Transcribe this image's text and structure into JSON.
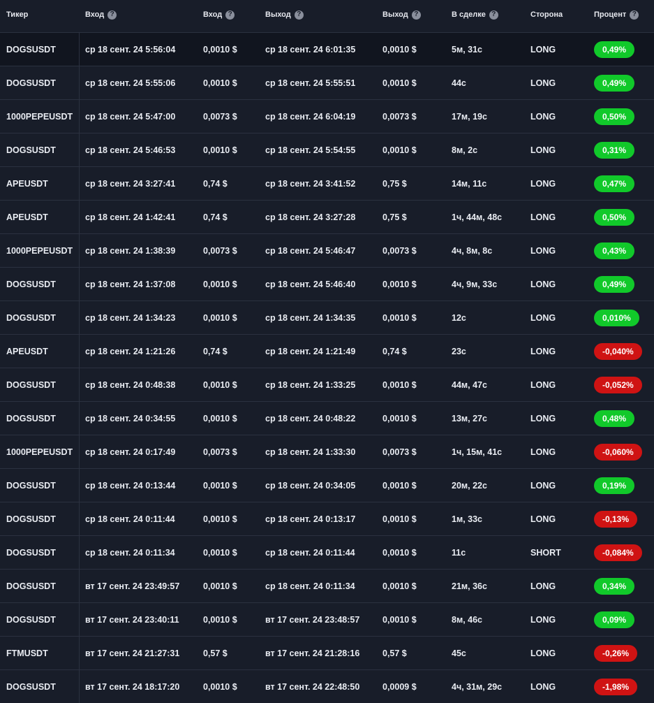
{
  "header": {
    "ticker": "Тикер",
    "entry_time": "Вход",
    "entry_price": "Вход",
    "exit_time": "Выход",
    "exit_price": "Выход",
    "duration": "В сделке",
    "side": "Сторона",
    "percent": "Процент",
    "help_glyph": "?"
  },
  "colors": {
    "positive": "#11c92a",
    "negative": "#cf1313"
  },
  "rows": [
    {
      "ticker": "DOGSUSDT",
      "entry_time": "ср 18 сент. 24 5:56:04",
      "entry_price": "0,0010 $",
      "exit_time": "ср 18 сент. 24 6:01:35",
      "exit_price": "0,0010 $",
      "duration": "5м, 31с",
      "side": "LONG",
      "percent": "0,49%",
      "sign": "pos"
    },
    {
      "ticker": "DOGSUSDT",
      "entry_time": "ср 18 сент. 24 5:55:06",
      "entry_price": "0,0010 $",
      "exit_time": "ср 18 сент. 24 5:55:51",
      "exit_price": "0,0010 $",
      "duration": "44с",
      "side": "LONG",
      "percent": "0,49%",
      "sign": "pos"
    },
    {
      "ticker": "1000PEPEUSDT",
      "entry_time": "ср 18 сент. 24 5:47:00",
      "entry_price": "0,0073 $",
      "exit_time": "ср 18 сент. 24 6:04:19",
      "exit_price": "0,0073 $",
      "duration": "17м, 19с",
      "side": "LONG",
      "percent": "0,50%",
      "sign": "pos"
    },
    {
      "ticker": "DOGSUSDT",
      "entry_time": "ср 18 сент. 24 5:46:53",
      "entry_price": "0,0010 $",
      "exit_time": "ср 18 сент. 24 5:54:55",
      "exit_price": "0,0010 $",
      "duration": "8м, 2с",
      "side": "LONG",
      "percent": "0,31%",
      "sign": "pos"
    },
    {
      "ticker": "APEUSDT",
      "entry_time": "ср 18 сент. 24 3:27:41",
      "entry_price": "0,74 $",
      "exit_time": "ср 18 сент. 24 3:41:52",
      "exit_price": "0,75 $",
      "duration": "14м, 11с",
      "side": "LONG",
      "percent": "0,47%",
      "sign": "pos"
    },
    {
      "ticker": "APEUSDT",
      "entry_time": "ср 18 сент. 24 1:42:41",
      "entry_price": "0,74 $",
      "exit_time": "ср 18 сент. 24 3:27:28",
      "exit_price": "0,75 $",
      "duration": "1ч, 44м, 48с",
      "side": "LONG",
      "percent": "0,50%",
      "sign": "pos"
    },
    {
      "ticker": "1000PEPEUSDT",
      "entry_time": "ср 18 сент. 24 1:38:39",
      "entry_price": "0,0073 $",
      "exit_time": "ср 18 сент. 24 5:46:47",
      "exit_price": "0,0073 $",
      "duration": "4ч, 8м, 8с",
      "side": "LONG",
      "percent": "0,43%",
      "sign": "pos"
    },
    {
      "ticker": "DOGSUSDT",
      "entry_time": "ср 18 сент. 24 1:37:08",
      "entry_price": "0,0010 $",
      "exit_time": "ср 18 сент. 24 5:46:40",
      "exit_price": "0,0010 $",
      "duration": "4ч, 9м, 33с",
      "side": "LONG",
      "percent": "0,49%",
      "sign": "pos"
    },
    {
      "ticker": "DOGSUSDT",
      "entry_time": "ср 18 сент. 24 1:34:23",
      "entry_price": "0,0010 $",
      "exit_time": "ср 18 сент. 24 1:34:35",
      "exit_price": "0,0010 $",
      "duration": "12с",
      "side": "LONG",
      "percent": "0,010%",
      "sign": "pos"
    },
    {
      "ticker": "APEUSDT",
      "entry_time": "ср 18 сент. 24 1:21:26",
      "entry_price": "0,74 $",
      "exit_time": "ср 18 сент. 24 1:21:49",
      "exit_price": "0,74 $",
      "duration": "23с",
      "side": "LONG",
      "percent": "-0,040%",
      "sign": "neg"
    },
    {
      "ticker": "DOGSUSDT",
      "entry_time": "ср 18 сент. 24 0:48:38",
      "entry_price": "0,0010 $",
      "exit_time": "ср 18 сент. 24 1:33:25",
      "exit_price": "0,0010 $",
      "duration": "44м, 47с",
      "side": "LONG",
      "percent": "-0,052%",
      "sign": "neg"
    },
    {
      "ticker": "DOGSUSDT",
      "entry_time": "ср 18 сент. 24 0:34:55",
      "entry_price": "0,0010 $",
      "exit_time": "ср 18 сент. 24 0:48:22",
      "exit_price": "0,0010 $",
      "duration": "13м, 27с",
      "side": "LONG",
      "percent": "0,48%",
      "sign": "pos"
    },
    {
      "ticker": "1000PEPEUSDT",
      "entry_time": "ср 18 сент. 24 0:17:49",
      "entry_price": "0,0073 $",
      "exit_time": "ср 18 сент. 24 1:33:30",
      "exit_price": "0,0073 $",
      "duration": "1ч, 15м, 41с",
      "side": "LONG",
      "percent": "-0,060%",
      "sign": "neg"
    },
    {
      "ticker": "DOGSUSDT",
      "entry_time": "ср 18 сент. 24 0:13:44",
      "entry_price": "0,0010 $",
      "exit_time": "ср 18 сент. 24 0:34:05",
      "exit_price": "0,0010 $",
      "duration": "20м, 22с",
      "side": "LONG",
      "percent": "0,19%",
      "sign": "pos"
    },
    {
      "ticker": "DOGSUSDT",
      "entry_time": "ср 18 сент. 24 0:11:44",
      "entry_price": "0,0010 $",
      "exit_time": "ср 18 сент. 24 0:13:17",
      "exit_price": "0,0010 $",
      "duration": "1м, 33с",
      "side": "LONG",
      "percent": "-0,13%",
      "sign": "neg"
    },
    {
      "ticker": "DOGSUSDT",
      "entry_time": "ср 18 сент. 24 0:11:34",
      "entry_price": "0,0010 $",
      "exit_time": "ср 18 сент. 24 0:11:44",
      "exit_price": "0,0010 $",
      "duration": "11с",
      "side": "SHORT",
      "percent": "-0,084%",
      "sign": "neg"
    },
    {
      "ticker": "DOGSUSDT",
      "entry_time": "вт 17 сент. 24 23:49:57",
      "entry_price": "0,0010 $",
      "exit_time": "ср 18 сент. 24 0:11:34",
      "exit_price": "0,0010 $",
      "duration": "21м, 36с",
      "side": "LONG",
      "percent": "0,34%",
      "sign": "pos"
    },
    {
      "ticker": "DOGSUSDT",
      "entry_time": "вт 17 сент. 24 23:40:11",
      "entry_price": "0,0010 $",
      "exit_time": "вт 17 сент. 24 23:48:57",
      "exit_price": "0,0010 $",
      "duration": "8м, 46с",
      "side": "LONG",
      "percent": "0,09%",
      "sign": "pos"
    },
    {
      "ticker": "FTMUSDT",
      "entry_time": "вт 17 сент. 24 21:27:31",
      "entry_price": "0,57 $",
      "exit_time": "вт 17 сент. 24 21:28:16",
      "exit_price": "0,57 $",
      "duration": "45с",
      "side": "LONG",
      "percent": "-0,26%",
      "sign": "neg"
    },
    {
      "ticker": "DOGSUSDT",
      "entry_time": "вт 17 сент. 24 18:17:20",
      "entry_price": "0,0010 $",
      "exit_time": "вт 17 сент. 24 22:48:50",
      "exit_price": "0,0009 $",
      "duration": "4ч, 31м, 29с",
      "side": "LONG",
      "percent": "-1,98%",
      "sign": "neg"
    }
  ]
}
